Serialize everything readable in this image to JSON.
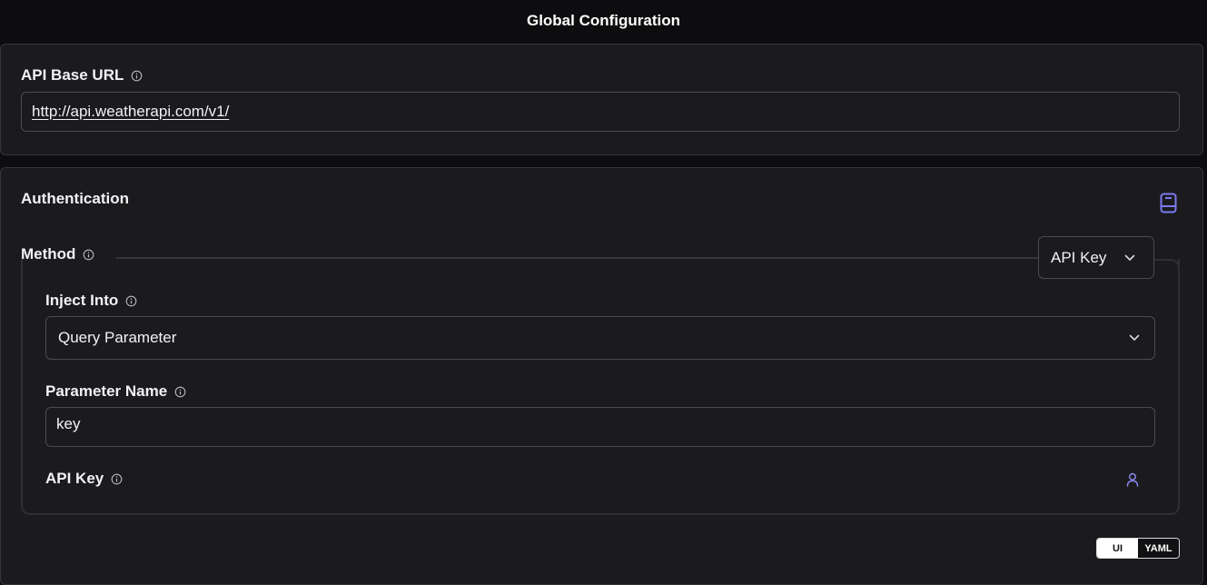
{
  "header": {
    "title": "Global Configuration"
  },
  "api_base_url": {
    "label": "API Base URL",
    "value": "http://api.weatherapi.com/v1/"
  },
  "authentication": {
    "title": "Authentication",
    "method": {
      "label": "Method",
      "selected": "API Key"
    },
    "inject_into": {
      "label": "Inject Into",
      "selected": "Query Parameter"
    },
    "parameter_name": {
      "label": "Parameter Name",
      "value": "key"
    },
    "api_key": {
      "label": "API Key"
    }
  },
  "view_toggle": {
    "options": [
      "UI",
      "YAML"
    ],
    "active": "UI"
  },
  "icons": {
    "info": "info-circle-icon",
    "docs": "book-icon",
    "chevron": "chevron-down-icon",
    "user": "user-icon"
  },
  "colors": {
    "accent": "#7b7bf2",
    "background": "#0d0d0f",
    "card": "#1b1b1e"
  }
}
